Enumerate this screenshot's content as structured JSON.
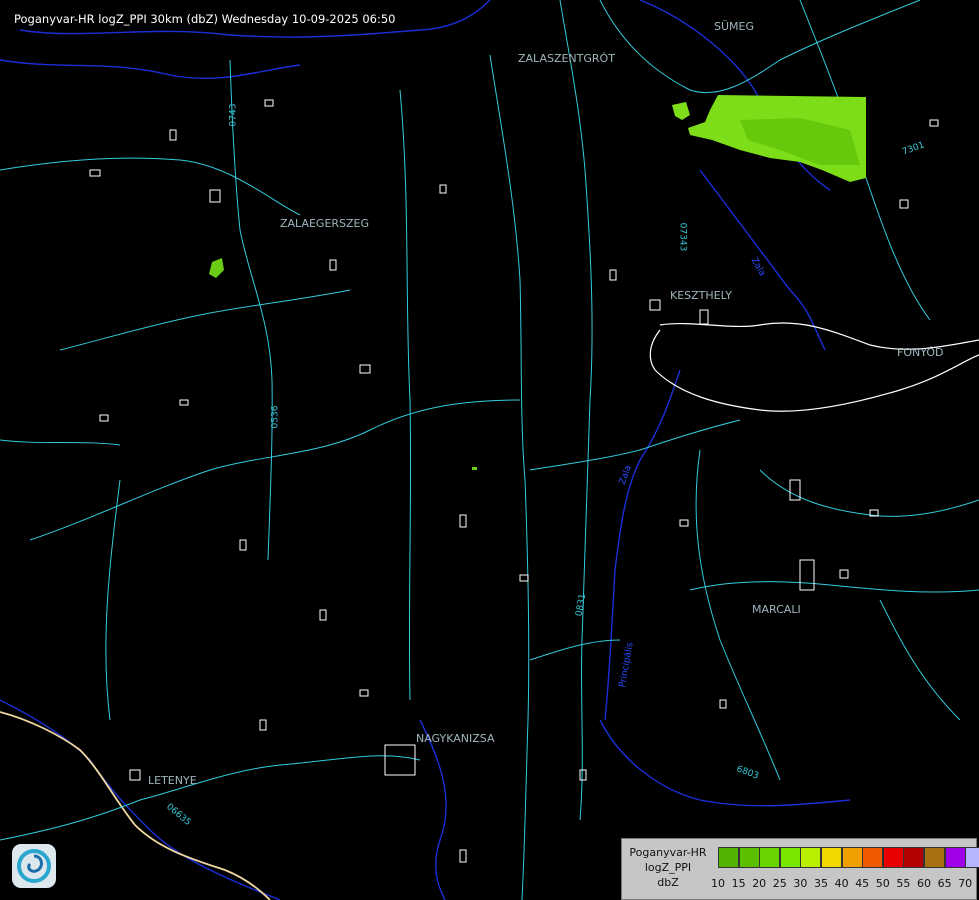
{
  "title": "Poganyvar-HR logZ_PPI 30km (dbZ) Wednesday 10-09-2025 06:50",
  "cities": [
    {
      "name": "SÜMEG",
      "key": "sumeg"
    },
    {
      "name": "ZALASZENTGRÓT",
      "key": "zalaszentgrot"
    },
    {
      "name": "ZALAEGERSZEG",
      "key": "zalaegerszeg"
    },
    {
      "name": "KESZTHELY",
      "key": "keszthely"
    },
    {
      "name": "FONYÓD",
      "key": "fonyod"
    },
    {
      "name": "MARCALI",
      "key": "marcali"
    },
    {
      "name": "NAGYKANIZSA",
      "key": "nagykanizsa"
    },
    {
      "name": "LETENYE",
      "key": "letenye"
    }
  ],
  "road_labels": [
    "0743",
    "07343",
    "0536",
    "0831",
    "6803",
    "06635",
    "7301"
  ],
  "river_labels": [
    "Zala",
    "Zala",
    "Principális"
  ],
  "legend": {
    "line1": "Poganyvar-HR",
    "line2": "logZ_PPI",
    "line3": "dbZ",
    "ticks": [
      "10",
      "15",
      "20",
      "25",
      "30",
      "35",
      "40",
      "45",
      "50",
      "55",
      "60",
      "65",
      "70"
    ],
    "colors": [
      "#52b400",
      "#5cc000",
      "#67d400",
      "#78e800",
      "#b8f000",
      "#f0d800",
      "#f0a000",
      "#f05a00",
      "#e80000",
      "#b40000",
      "#a87010",
      "#a000e8",
      "#b4b4ff"
    ]
  },
  "colors": {
    "road": "#33ccdd",
    "river": "#1a2fd8",
    "border": "#f0d8a0",
    "echo_light": "#7ddd19",
    "echo_dark": "#55b800"
  }
}
